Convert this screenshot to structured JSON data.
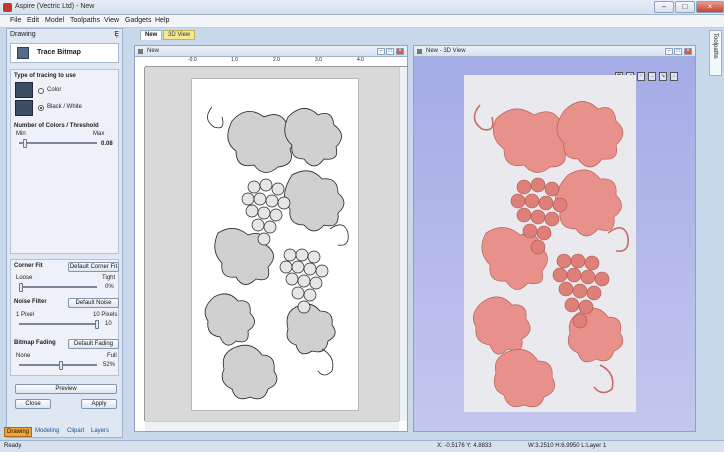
{
  "window": {
    "title": "Aspire (Vectric Ltd) - New"
  },
  "menu": [
    "File",
    "Edit",
    "Model",
    "Toolpaths",
    "View",
    "Gadgets",
    "Help"
  ],
  "panel": {
    "title": "Drawing",
    "pin": "Ȩ",
    "header": "Trace Bitmap",
    "type_label": "Type of tracing to use",
    "opt_color": "Color",
    "opt_bw": "Black / White",
    "colors_label": "Number of Colors / Threshold",
    "min": "Min",
    "max": "Max",
    "threshold_value": "0.08",
    "threshold_level": 0.05,
    "corner_label": "Corner Fit",
    "corner_button": "Default Corner Fit",
    "loose": "Loose",
    "tight": "Tight",
    "corner_value": "0%",
    "corner_level": 0,
    "noise_label": "Noise Filter",
    "noise_button": "Default Noise",
    "noise_min": "1 Pixel",
    "noise_max": "10 Pixels",
    "noise_value": "10",
    "noise_level": 1,
    "fading_label": "Bitmap Fading",
    "fading_button": "Default Fading",
    "none": "None",
    "full": "Full",
    "fading_value": "52%",
    "fading_level": 0.52,
    "preview": "Preview",
    "close": "Close",
    "apply": "Apply"
  },
  "bottom_tabs": [
    "Drawing",
    "Modeling",
    "Clipart",
    "Layers"
  ],
  "doc_tabs": [
    "New",
    "3D View"
  ],
  "win2d": {
    "title": "New",
    "ruler": [
      "-0.0",
      "1.0",
      "2.0",
      "3.0",
      "4.0"
    ]
  },
  "win3d": {
    "title": "New - 3D View"
  },
  "side_tab": "Toolpaths",
  "status": {
    "ready": "Ready",
    "xy": "X: -0.5176 Y: 4.8833",
    "wh": "W:3.2510  H:6.9950  L:Layer 1"
  },
  "colors": {
    "accent": "#f0a53a",
    "relief": "#e8918a",
    "view3d_bg": "#b3b8e6"
  }
}
